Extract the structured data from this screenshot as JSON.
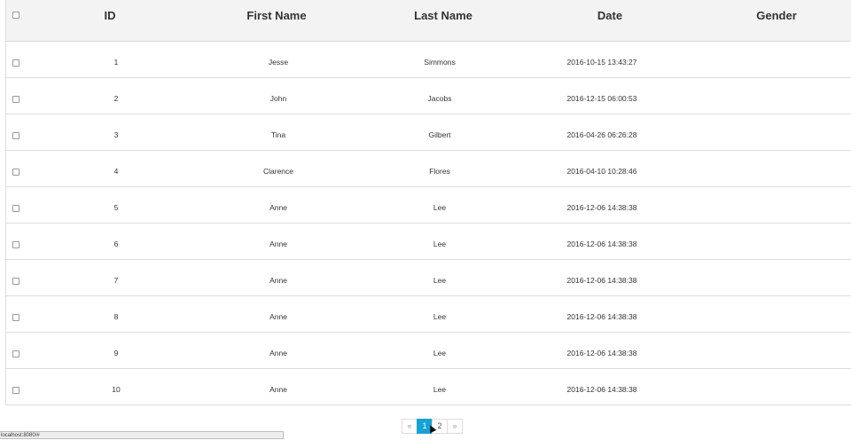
{
  "table": {
    "headers": {
      "id": "ID",
      "first_name": "First Name",
      "last_name": "Last Name",
      "date": "Date",
      "gender": "Gender"
    },
    "rows": [
      {
        "id": "1",
        "first_name": "Jesse",
        "last_name": "Simmons",
        "date": "2016-10-15 13:43:27",
        "gender": ""
      },
      {
        "id": "2",
        "first_name": "John",
        "last_name": "Jacobs",
        "date": "2016-12-15 06:00:53",
        "gender": ""
      },
      {
        "id": "3",
        "first_name": "Tina",
        "last_name": "Gilbert",
        "date": "2016-04-26 06:26:28",
        "gender": ""
      },
      {
        "id": "4",
        "first_name": "Clarence",
        "last_name": "Flores",
        "date": "2016-04-10 10:28:46",
        "gender": ""
      },
      {
        "id": "5",
        "first_name": "Anne",
        "last_name": "Lee",
        "date": "2016-12-06 14:38:38",
        "gender": ""
      },
      {
        "id": "6",
        "first_name": "Anne",
        "last_name": "Lee",
        "date": "2016-12-06 14:38:38",
        "gender": ""
      },
      {
        "id": "7",
        "first_name": "Anne",
        "last_name": "Lee",
        "date": "2016-12-06 14:38:38",
        "gender": ""
      },
      {
        "id": "8",
        "first_name": "Anne",
        "last_name": "Lee",
        "date": "2016-12-06 14:38:38",
        "gender": ""
      },
      {
        "id": "9",
        "first_name": "Anne",
        "last_name": "Lee",
        "date": "2016-12-06 14:38:38",
        "gender": ""
      },
      {
        "id": "10",
        "first_name": "Anne",
        "last_name": "Lee",
        "date": "2016-12-06 14:38:38",
        "gender": ""
      }
    ]
  },
  "pagination": {
    "prev": "«",
    "pages": [
      "1",
      "2"
    ],
    "next": "»",
    "active": "1"
  },
  "status_bar": {
    "url": "localhost:8080/#"
  },
  "colors": {
    "accent": "#17a2d6",
    "header_bg": "#f3f3f3",
    "border": "#dddddd"
  }
}
